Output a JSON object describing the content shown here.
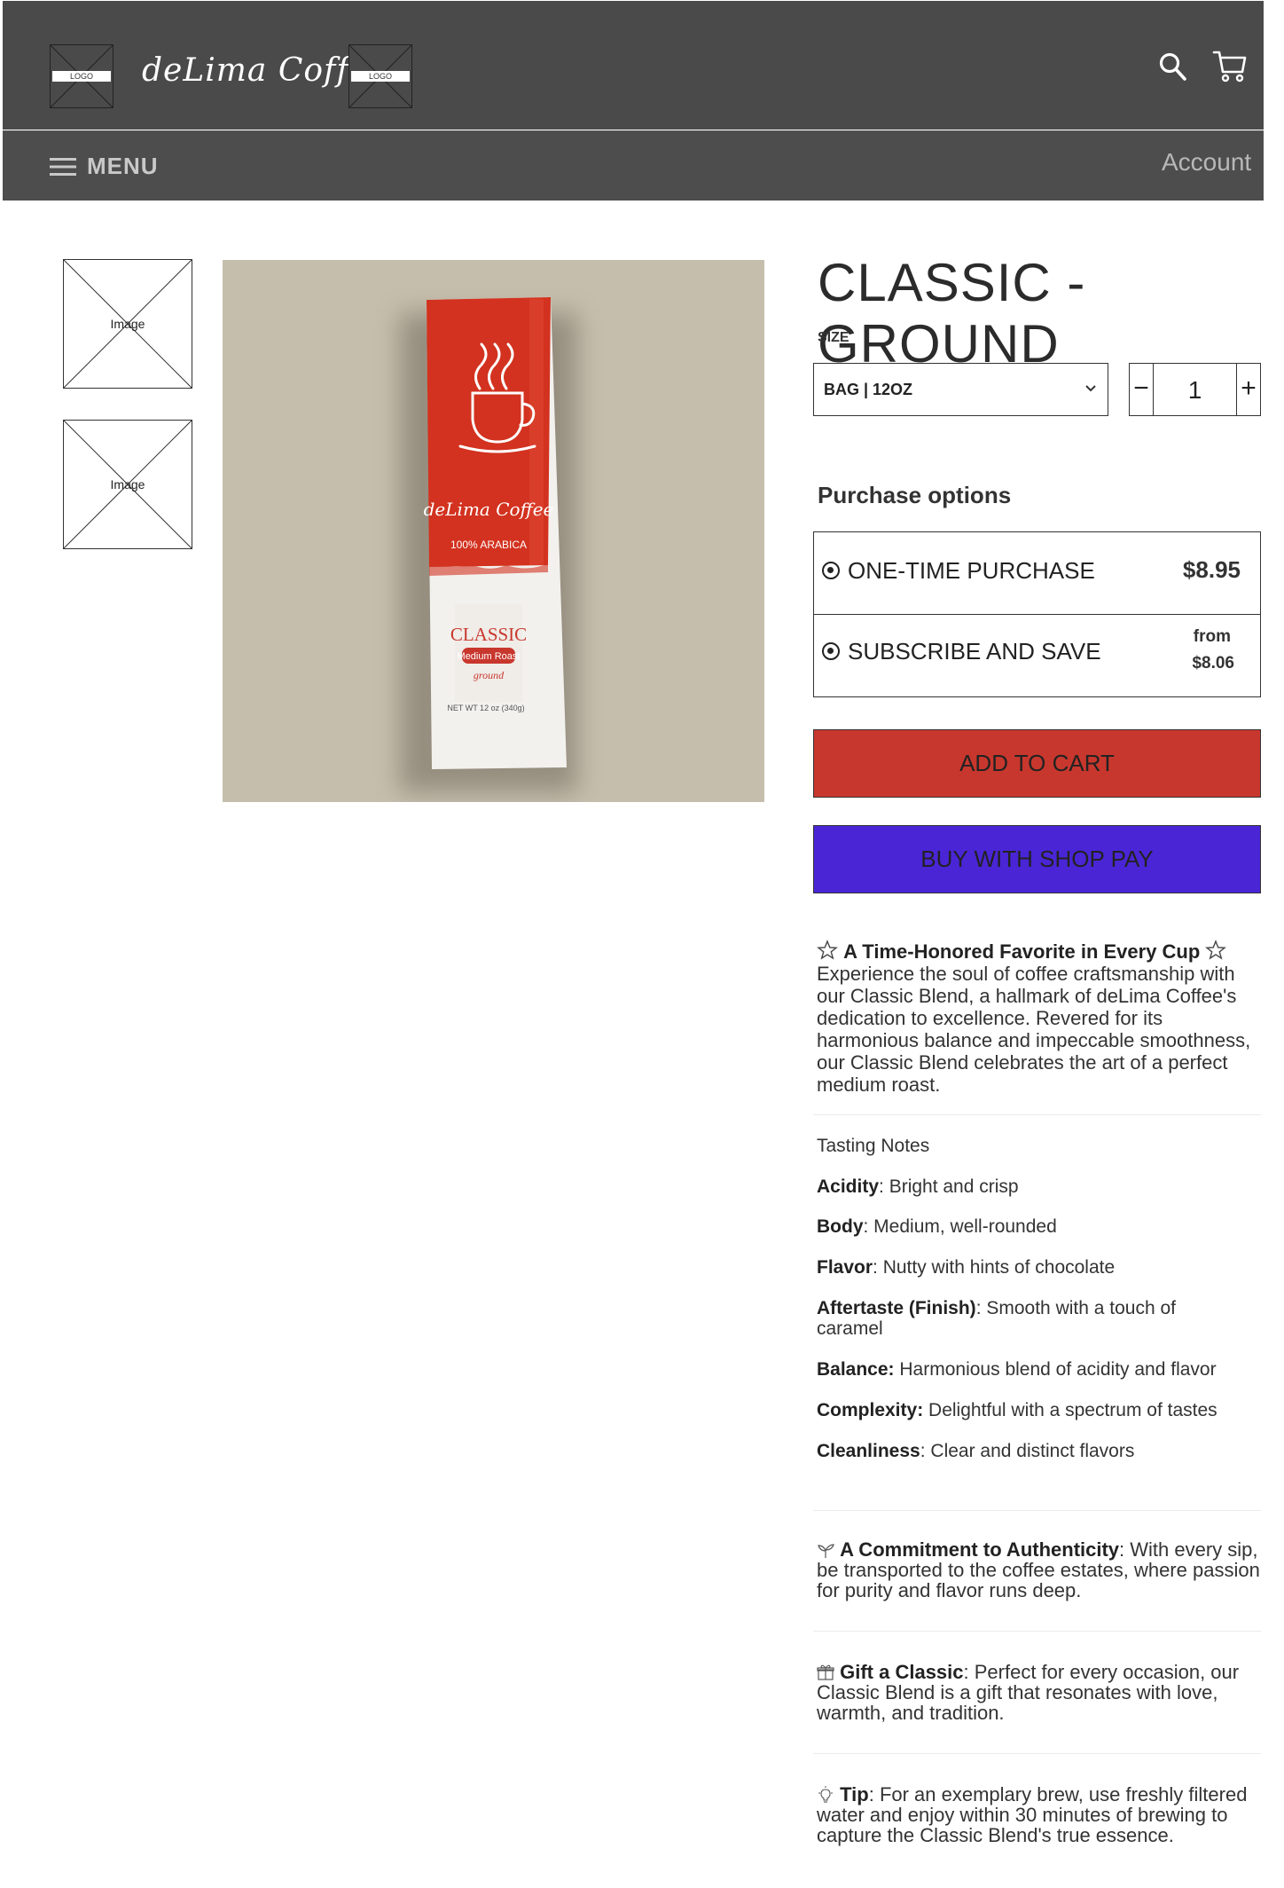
{
  "header": {
    "logo_left_text": "LOGO",
    "brand": "deLima Coffee",
    "logo_right_text": "LOGO",
    "search_icon": "search-icon",
    "cart_icon": "cart-icon"
  },
  "nav": {
    "menu_label": "MENU",
    "menu_icon": "hamburger-icon",
    "account_label": "Account"
  },
  "gallery": {
    "thumbnails": [
      {
        "label": "Image"
      },
      {
        "label": "Image"
      }
    ]
  },
  "product": {
    "title": "CLASSIC - GROUND",
    "size_label": "SIZE",
    "size_value": "BAG | 12OZ",
    "quantity": "1",
    "minus_label": "−",
    "plus_label": "+",
    "package": {
      "brand": "deLima Coffee",
      "origin": "100% ARABICA",
      "name": "CLASSIC",
      "roast": "Medium Roast",
      "grind": "ground",
      "weight": "NET WT 12 oz (340g)"
    }
  },
  "purchase": {
    "heading": "Purchase options",
    "one_time_label": "ONE-TIME PURCHASE",
    "one_time_price": "$8.95",
    "subscribe_label": "SUBSCRIBE AND SAVE",
    "subscribe_from": "from",
    "subscribe_price": "$8.06",
    "add_to_cart": "ADD TO CART",
    "shop_pay": "BUY WITH SHOP PAY"
  },
  "description": {
    "headline": "A Time-Honored Favorite in Every Cup",
    "intro": "Experience the soul of coffee craftsmanship with our Classic Blend, a hallmark of deLima Coffee's dedication to excellence. Revered for its harmonious balance and impeccable smoothness, our Classic Blend celebrates the art of a perfect medium roast.",
    "tasting_heading": "Tasting Notes",
    "notes": [
      {
        "term": "Acidity",
        "sep": ": ",
        "value": "Bright and crisp"
      },
      {
        "term": "Body",
        "sep": ": ",
        "value": "Medium, well-rounded"
      },
      {
        "term": "Flavor",
        "sep": ": ",
        "value": "Nutty with hints of chocolate"
      },
      {
        "term": "Aftertaste (Finish)",
        "sep": ": ",
        "value": "Smooth with a touch of caramel"
      },
      {
        "term": "Balance:",
        "sep": " ",
        "value": "Harmonious blend of acidity and flavor"
      },
      {
        "term": "Complexity:",
        "sep": " ",
        "value": "Delightful with a spectrum of tastes"
      },
      {
        "term": "Cleanliness",
        "sep": ": ",
        "value": "Clear and distinct flavors"
      }
    ],
    "authenticity_term": "A Commitment to Authenticity",
    "authenticity_text": ": With every sip, be transported to the coffee estates, where passion for purity and flavor runs deep.",
    "gift_term": "Gift a Classic",
    "gift_text": ": Perfect for every occasion, our Classic Blend is a gift that resonates with love, warmth, and tradition.",
    "tip_term": "Tip",
    "tip_text": ": For an exemplary brew, use freshly filtered water and enjoy within 30 minutes of brewing to capture the Classic Blend's true essence."
  },
  "colors": {
    "header_bg": "#4a4a4a",
    "add_to_cart_bg": "#c8372d",
    "shop_pay_bg": "#4a25d6",
    "bag_red": "#d2321f"
  }
}
